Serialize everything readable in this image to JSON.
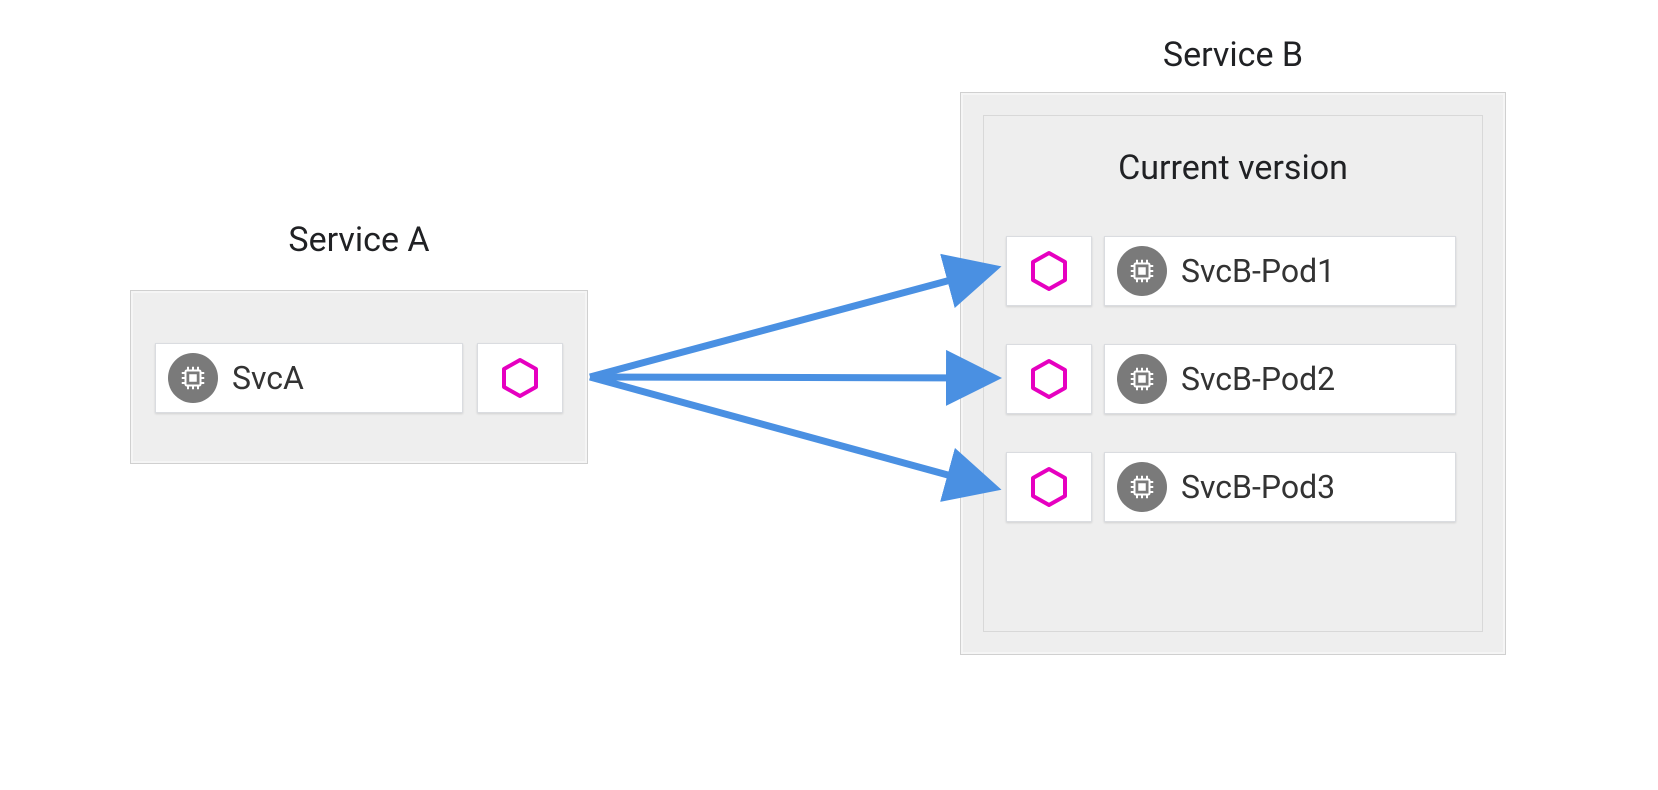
{
  "serviceA": {
    "title": "Service A",
    "pod": "SvcA"
  },
  "serviceB": {
    "title": "Service B",
    "subtitle": "Current version",
    "pods": [
      "SvcB-Pod1",
      "SvcB-Pod2",
      "SvcB-Pod3"
    ]
  },
  "colors": {
    "hex": "#e600c0",
    "arrow": "#4a90e2",
    "chipBg": "#7a7a7a"
  }
}
